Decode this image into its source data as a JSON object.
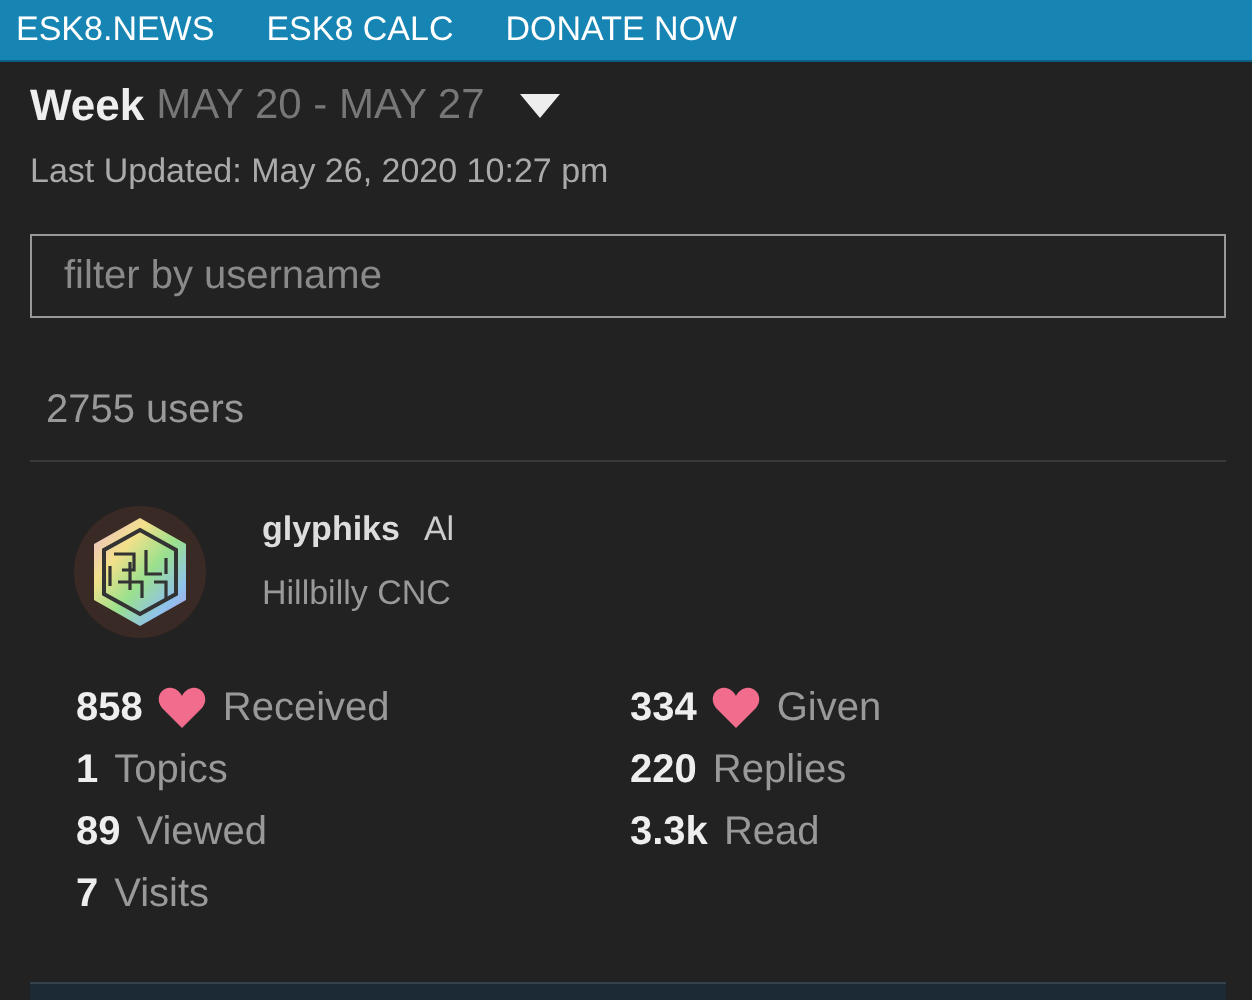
{
  "nav": [
    "ESK8.NEWS",
    "ESK8 CALC",
    "DONATE NOW"
  ],
  "period": {
    "label": "Week",
    "range": "MAY 20 - MAY 27"
  },
  "last_updated": "Last Updated: May 26, 2020 10:27 pm",
  "filter": {
    "placeholder": "filter by username"
  },
  "user_count": "2755 users",
  "user": {
    "username": "glyphiks",
    "name": "Al",
    "title": "Hillbilly CNC"
  },
  "stat_columns": [
    {
      "stats": [
        {
          "kind": "heart",
          "count": "858",
          "label": "Received"
        },
        {
          "kind": "plain",
          "count": "1",
          "label": "Topics"
        },
        {
          "kind": "plain",
          "count": "89",
          "label": "Viewed"
        },
        {
          "kind": "plain",
          "count": "7",
          "label": "Visits"
        }
      ]
    },
    {
      "stats": [
        {
          "kind": "heart",
          "count": "334",
          "label": "Given"
        },
        {
          "kind": "plain",
          "count": "220",
          "label": "Replies"
        },
        {
          "kind": "plain",
          "count": "3.3k",
          "label": "Read"
        }
      ]
    }
  ]
}
